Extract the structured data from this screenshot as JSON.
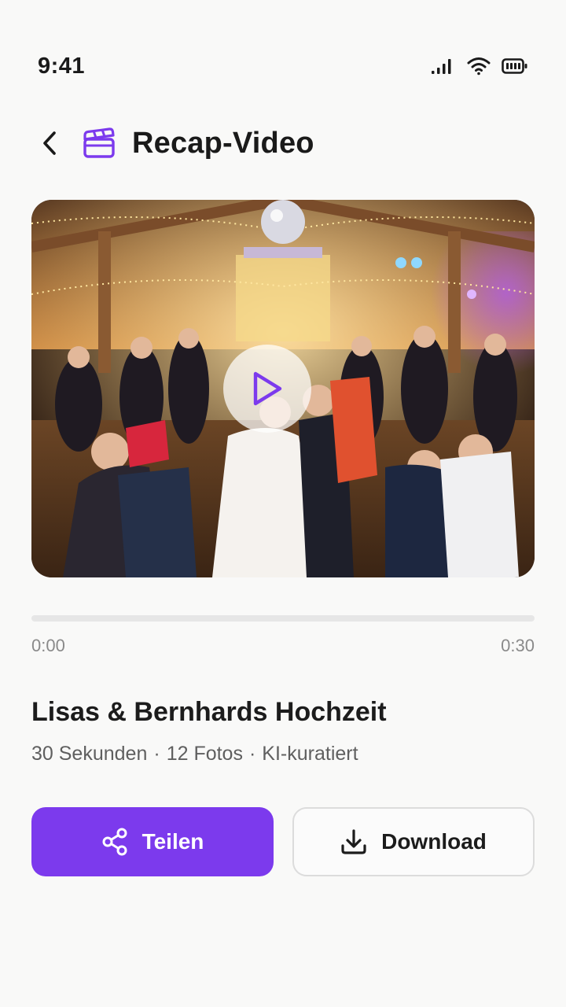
{
  "status_bar": {
    "time": "9:41",
    "icons": [
      "signal-icon",
      "wifi-icon",
      "battery-icon"
    ]
  },
  "header": {
    "back_icon": "chevron-left-icon",
    "title_icon": "clapperboard-icon",
    "title": "Recap-Video"
  },
  "video": {
    "thumbnail": "wedding reception dance floor",
    "play_icon": "play-icon",
    "progress": 0.0,
    "time_current": "0:00",
    "time_total": "0:30"
  },
  "event": {
    "title": "Lisas & Bernhards Hochzeit",
    "meta": [
      "30 Sekunden",
      "12 Fotos",
      "KI-kuratiert"
    ],
    "separator": "·"
  },
  "actions": {
    "share_label": "Teilen",
    "share_icon": "share-icon",
    "download_label": "Download",
    "download_icon": "download-icon"
  },
  "colors": {
    "accent": "#7c3aed",
    "background": "#f9f9f8",
    "text": "#1c1c1c",
    "muted": "#8a8a8a"
  }
}
